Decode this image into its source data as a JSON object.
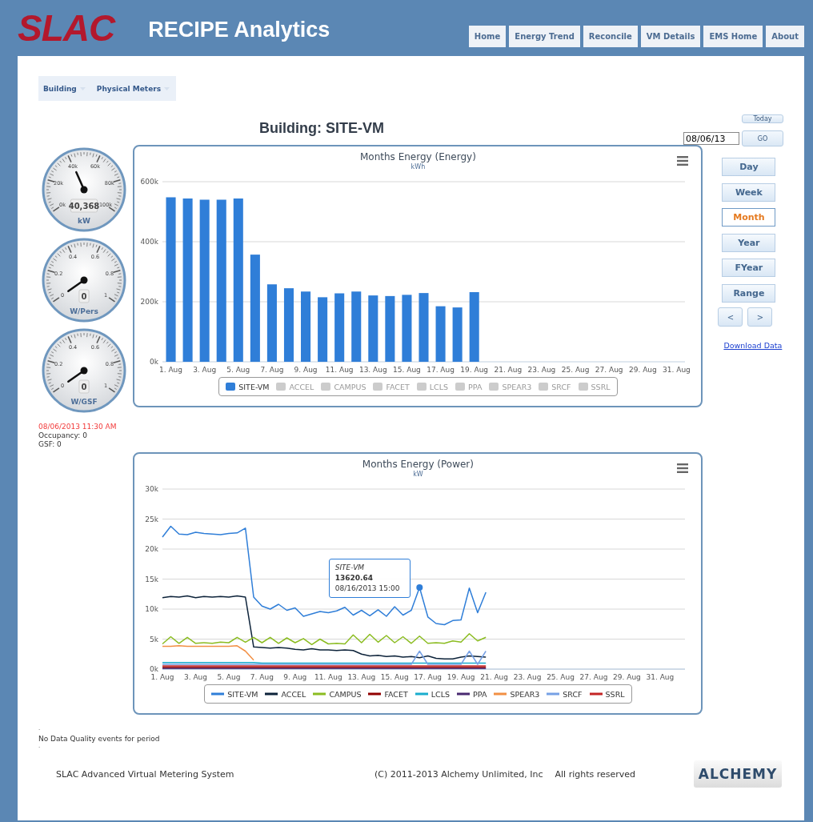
{
  "header": {
    "logo": "SLAC",
    "title": "RECIPE Analytics",
    "nav": [
      {
        "label": "Home"
      },
      {
        "label": "Energy Trend"
      },
      {
        "label": "Reconcile"
      },
      {
        "label": "VM Details"
      },
      {
        "label": "EMS Home"
      },
      {
        "label": "About"
      }
    ]
  },
  "tabs": [
    {
      "label": "Building"
    },
    {
      "label": "Physical Meters"
    }
  ],
  "page_title": "Building: SITE-VM",
  "date_controls": {
    "today": "Today",
    "date": "08/06/13",
    "go": "GO"
  },
  "gauges": [
    {
      "ticks": [
        "0k",
        "20k",
        "40k",
        "60k",
        "80k",
        "100k"
      ],
      "value": "40,368",
      "unit": "kW"
    },
    {
      "ticks": [
        "0",
        "0.2",
        "0.4",
        "0.6",
        "0.8",
        "1"
      ],
      "value": "0",
      "unit": "W/Pers"
    },
    {
      "ticks": [
        "0",
        "0.2",
        "0.4",
        "0.6",
        "0.8",
        "1"
      ],
      "value": "0",
      "unit": "W/GSF"
    }
  ],
  "status": {
    "timestamp": "08/06/2013 11:30 AM",
    "lines": [
      "Occupancy: 0",
      "GSF: 0"
    ]
  },
  "energy_chart": {
    "title": "Months Energy (Energy)",
    "subtitle": "kWh",
    "chart_data": {
      "type": "bar",
      "categories": [
        "1. Aug",
        null,
        "3. Aug",
        null,
        "5. Aug",
        null,
        "7. Aug",
        null,
        "9. Aug",
        null,
        "11. Aug",
        null,
        "13. Aug",
        null,
        "15. Aug",
        null,
        "17. Aug",
        null,
        "19. Aug",
        null,
        "21. Aug",
        null,
        "23. Aug",
        null,
        "25. Aug",
        null,
        "27. Aug",
        null,
        "29. Aug",
        null,
        "31. Aug"
      ],
      "series": [
        {
          "name": "SITE-VM",
          "color": "#2f7ed8",
          "values": [
            548000,
            544000,
            540000,
            540000,
            544000,
            357000,
            258000,
            245000,
            234000,
            215000,
            228000,
            234000,
            221000,
            219000,
            223000,
            229000,
            185000,
            181000,
            232000,
            null,
            null,
            null,
            null,
            null,
            null,
            null,
            null,
            null,
            null,
            null,
            null
          ]
        }
      ],
      "ylim": [
        0,
        600000
      ],
      "grid": true,
      "yticks": [
        {
          "value": 0,
          "label": "0k"
        },
        {
          "value": 200000,
          "label": "200k"
        },
        {
          "value": 400000,
          "label": "400k"
        },
        {
          "value": 600000,
          "label": "600k"
        }
      ]
    },
    "legend": [
      {
        "name": "ACCEL",
        "visible": false
      },
      {
        "name": "CAMPUS",
        "visible": false
      },
      {
        "name": "FACET",
        "visible": false
      },
      {
        "name": "LCLS",
        "visible": false
      },
      {
        "name": "PPA",
        "visible": false
      },
      {
        "name": "SPEAR3",
        "visible": false
      },
      {
        "name": "SRCF",
        "visible": false
      },
      {
        "name": "SSRL",
        "visible": false
      }
    ]
  },
  "power_tooltip": {
    "series": "SITE-VM",
    "value": "13620.64",
    "time": "08/16/2013 15:00"
  },
  "power_chart": {
    "title": "Months Energy (Power)",
    "subtitle": "kW",
    "chart_data": {
      "type": "line",
      "categories": [
        "1. Aug",
        null,
        null,
        null,
        "3. Aug",
        null,
        null,
        null,
        "5. Aug",
        null,
        null,
        null,
        "7. Aug",
        null,
        null,
        null,
        "9. Aug",
        null,
        null,
        null,
        "11. Aug",
        null,
        null,
        null,
        "13. Aug",
        null,
        null,
        null,
        "15. Aug",
        null,
        null,
        null,
        "17. Aug",
        null,
        null,
        null,
        "19. Aug",
        null,
        null,
        null,
        "21. Aug",
        null,
        null,
        null,
        "23. Aug",
        null,
        null,
        null,
        "25. Aug",
        null,
        null,
        null,
        "27. Aug",
        null,
        null,
        null,
        "29. Aug",
        null,
        null,
        null,
        "31. Aug",
        null,
        null
      ],
      "series": [
        {
          "name": "SITE-VM",
          "color": "#2f7ed8",
          "values": [
            22000,
            23800,
            22500,
            22400,
            22800,
            22600,
            22500,
            22400,
            22600,
            22700,
            23500,
            12000,
            10500,
            10000,
            10800,
            9800,
            10200,
            8800,
            9200,
            9600,
            9400,
            9700,
            10300,
            9000,
            9800,
            8900,
            9900,
            8800,
            10400,
            9000,
            9800,
            13600,
            8700,
            7600,
            7400,
            8100,
            8200,
            13500,
            9400,
            12800,
            null,
            null,
            null,
            null,
            null,
            null,
            null,
            null,
            null,
            null,
            null,
            null,
            null,
            null,
            null,
            null,
            null,
            null,
            null,
            null,
            null,
            null,
            null
          ]
        },
        {
          "name": "ACCEL",
          "color": "#0d233a",
          "values": [
            11900,
            12100,
            12000,
            12200,
            11900,
            12100,
            12000,
            12100,
            12000,
            12200,
            12000,
            3700,
            3600,
            3500,
            3600,
            3500,
            3300,
            3200,
            3400,
            3200,
            3200,
            3100,
            3200,
            3100,
            2500,
            2200,
            2300,
            2100,
            2200,
            2000,
            2100,
            1900,
            2200,
            1800,
            1700,
            1700,
            2000,
            2200,
            2100,
            2000,
            null,
            null,
            null,
            null,
            null,
            null,
            null,
            null,
            null,
            null,
            null,
            null,
            null,
            null,
            null,
            null,
            null,
            null,
            null,
            null,
            null,
            null,
            null
          ]
        },
        {
          "name": "CAMPUS",
          "color": "#8bbc21",
          "values": [
            4200,
            5400,
            4300,
            5300,
            4300,
            4400,
            4300,
            4500,
            4400,
            5300,
            4500,
            5300,
            4400,
            5300,
            4300,
            5200,
            4400,
            5100,
            4100,
            5000,
            4200,
            4300,
            4200,
            5700,
            4400,
            5800,
            4500,
            5600,
            4400,
            5400,
            4300,
            5500,
            4300,
            4400,
            4300,
            4700,
            4500,
            5900,
            4700,
            5300,
            null,
            null,
            null,
            null,
            null,
            null,
            null,
            null,
            null,
            null,
            null,
            null,
            null,
            null,
            null,
            null,
            null,
            null,
            null,
            null,
            null,
            null,
            null
          ]
        },
        {
          "name": "FACET",
          "color": "#910000",
          "values": [
            300,
            300,
            300,
            300,
            300,
            300,
            300,
            300,
            300,
            300,
            300,
            300,
            300,
            300,
            300,
            300,
            300,
            300,
            300,
            300,
            300,
            300,
            300,
            300,
            300,
            300,
            300,
            300,
            300,
            300,
            300,
            300,
            300,
            300,
            300,
            300,
            300,
            300,
            300,
            300,
            null,
            null,
            null,
            null,
            null,
            null,
            null,
            null,
            null,
            null,
            null,
            null,
            null,
            null,
            null,
            null,
            null,
            null,
            null,
            null,
            null,
            null,
            null
          ]
        },
        {
          "name": "LCLS",
          "color": "#1aadce",
          "values": [
            1100,
            1100,
            1100,
            1100,
            1100,
            1100,
            1100,
            1100,
            1100,
            1100,
            1100,
            1100,
            1000,
            1000,
            1000,
            1000,
            1000,
            1000,
            1000,
            1000,
            1000,
            1000,
            1000,
            1000,
            1000,
            1000,
            1000,
            1000,
            1000,
            1000,
            1000,
            1000,
            1000,
            1000,
            1000,
            1000,
            1000,
            1000,
            1000,
            1000,
            null,
            null,
            null,
            null,
            null,
            null,
            null,
            null,
            null,
            null,
            null,
            null,
            null,
            null,
            null,
            null,
            null,
            null,
            null,
            null,
            null,
            null,
            null
          ]
        },
        {
          "name": "PPA",
          "color": "#492970",
          "values": [
            100,
            100,
            100,
            100,
            100,
            100,
            100,
            100,
            100,
            100,
            100,
            100,
            100,
            100,
            100,
            100,
            100,
            100,
            100,
            100,
            100,
            100,
            100,
            100,
            100,
            100,
            100,
            100,
            100,
            100,
            100,
            100,
            100,
            100,
            100,
            100,
            100,
            100,
            100,
            100,
            null,
            null,
            null,
            null,
            null,
            null,
            null,
            null,
            null,
            null,
            null,
            null,
            null,
            null,
            null,
            null,
            null,
            null,
            null,
            null,
            null,
            null,
            null
          ]
        },
        {
          "name": "SPEAR3",
          "color": "#f28f43",
          "values": [
            3800,
            3800,
            3900,
            3800,
            3800,
            3800,
            3800,
            3800,
            3800,
            3900,
            3000,
            1500,
            null,
            null,
            null,
            null,
            null,
            null,
            null,
            null,
            null,
            null,
            null,
            null,
            null,
            null,
            null,
            null,
            null,
            null,
            null,
            null,
            null,
            null,
            null,
            null,
            null,
            null,
            null,
            null,
            null,
            null,
            null,
            null,
            null,
            null,
            null,
            null,
            null,
            null,
            null,
            null,
            null,
            null,
            null,
            null,
            null,
            null,
            null,
            null,
            null,
            null,
            null
          ]
        },
        {
          "name": "SRCF",
          "color": "#77a1e5",
          "values": [
            800,
            800,
            800,
            800,
            800,
            800,
            800,
            800,
            800,
            800,
            800,
            800,
            800,
            800,
            800,
            800,
            800,
            800,
            800,
            800,
            800,
            800,
            800,
            800,
            800,
            800,
            800,
            800,
            800,
            800,
            800,
            3000,
            800,
            800,
            800,
            800,
            800,
            3000,
            800,
            3000,
            null,
            null,
            null,
            null,
            null,
            null,
            null,
            null,
            null,
            null,
            null,
            null,
            null,
            null,
            null,
            null,
            null,
            null,
            null,
            null,
            null,
            null,
            null
          ]
        },
        {
          "name": "SSRL",
          "color": "#c42525",
          "values": [
            550,
            550,
            550,
            550,
            550,
            550,
            550,
            550,
            550,
            550,
            550,
            550,
            550,
            550,
            550,
            550,
            550,
            550,
            550,
            550,
            550,
            550,
            550,
            550,
            550,
            550,
            550,
            550,
            550,
            550,
            550,
            550,
            550,
            550,
            550,
            550,
            550,
            550,
            550,
            550,
            null,
            null,
            null,
            null,
            null,
            null,
            null,
            null,
            null,
            null,
            null,
            null,
            null,
            null,
            null,
            null,
            null,
            null,
            null,
            null,
            null,
            null,
            null
          ]
        }
      ],
      "ylim": [
        0,
        30000
      ],
      "grid": true,
      "yticks": [
        {
          "value": 0,
          "label": "0k"
        },
        {
          "value": 5000,
          "label": "5k"
        },
        {
          "value": 10000,
          "label": "10k"
        },
        {
          "value": 15000,
          "label": "15k"
        },
        {
          "value": 20000,
          "label": "20k"
        },
        {
          "value": 25000,
          "label": "25k"
        },
        {
          "value": 30000,
          "label": "30k"
        }
      ]
    }
  },
  "periods": [
    {
      "label": "Day",
      "selected": false
    },
    {
      "label": "Week",
      "selected": false
    },
    {
      "label": "Month",
      "selected": true
    },
    {
      "label": "Year",
      "selected": false
    },
    {
      "label": "FYear",
      "selected": false
    },
    {
      "label": "Range",
      "selected": false
    }
  ],
  "nav_arrows": [
    "<",
    ">"
  ],
  "download_link": "Download Data",
  "notes": [
    ".",
    "No Data Quality events for period",
    "."
  ],
  "footer": {
    "system": "SLAC Advanced Virtual Metering System",
    "copyright": "(C) 2011-2013 Alchemy Unlimited, Inc",
    "rights": "All rights reserved",
    "logo": "ALCHEMY"
  }
}
